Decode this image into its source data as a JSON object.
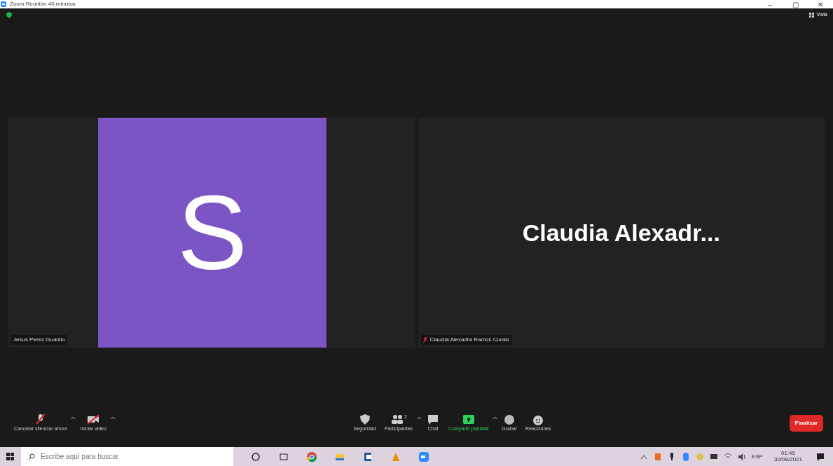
{
  "window": {
    "title": "Zoom Reunión 40 minutos",
    "controls": [
      "–",
      "▢",
      "✕"
    ]
  },
  "view_button": {
    "label": "Vista"
  },
  "tiles": [
    {
      "kind": "avatar",
      "initial": "S",
      "name": "Jesus Perez Guanilo",
      "muted": false
    },
    {
      "kind": "name",
      "display_name": "Claudia  Alexadr...",
      "name": "Claudia Alexadra Ramos Curasi",
      "muted": true
    }
  ],
  "toolbar": [
    {
      "kind": "mic",
      "label": "Cancelar silenciar ahora",
      "caret": true,
      "highlight": false
    },
    {
      "kind": "video",
      "label": "Iniciar video",
      "caret": true,
      "highlight": false
    },
    {
      "kind": "gap"
    },
    {
      "kind": "shield",
      "label": "Seguridad",
      "caret": false,
      "highlight": false
    },
    {
      "kind": "people",
      "label": "Participantes",
      "count": "2",
      "caret": true,
      "highlight": false
    },
    {
      "kind": "chat",
      "label": "Chat",
      "caret": false,
      "highlight": false
    },
    {
      "kind": "share",
      "label": "Compartir pantalla",
      "caret": true,
      "highlight": true
    },
    {
      "kind": "record",
      "label": "Grabar",
      "caret": false,
      "highlight": false
    },
    {
      "kind": "react",
      "label": "Reacciones",
      "caret": false,
      "highlight": false
    }
  ],
  "end_button": {
    "label": "Finalizar"
  },
  "taskbar": {
    "search_placeholder": "Escribe aquí para buscar",
    "language": "ESP",
    "time": "01:45",
    "date": "30/08/2021"
  }
}
